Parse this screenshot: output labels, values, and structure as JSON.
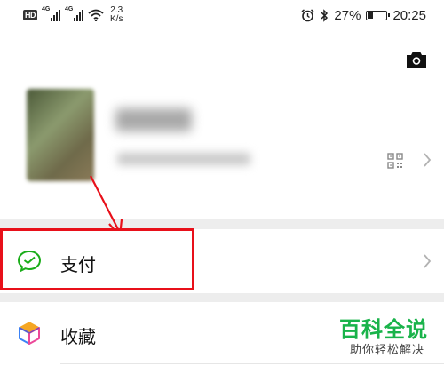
{
  "status_bar": {
    "hd": "HD",
    "signal_tag_1": "4G",
    "signal_tag_2": "4G",
    "net_speed_value": "2.3",
    "net_speed_unit": "K/s",
    "battery_percent": "27%",
    "battery_level": 0.27,
    "time": "20:25",
    "icons": [
      "signal-icon",
      "wifi-icon",
      "alarm-icon",
      "bluetooth-icon",
      "battery-icon"
    ]
  },
  "header": {
    "camera_icon": "camera-icon"
  },
  "profile": {
    "qr_icon": "qr-code-icon",
    "chevron_icon": "chevron-right-icon"
  },
  "menu": {
    "items": [
      {
        "label": "支付",
        "icon": "wechat-pay-icon",
        "icon_color": "#1aad19"
      },
      {
        "label": "收藏",
        "icon": "favorites-cube-icon",
        "icon_color": "#f5a623"
      }
    ]
  },
  "annotation": {
    "highlight_color": "#e8101a"
  },
  "watermark": {
    "title": "百科全说",
    "subtitle": "助你轻松解决",
    "color": "#19b34a"
  }
}
